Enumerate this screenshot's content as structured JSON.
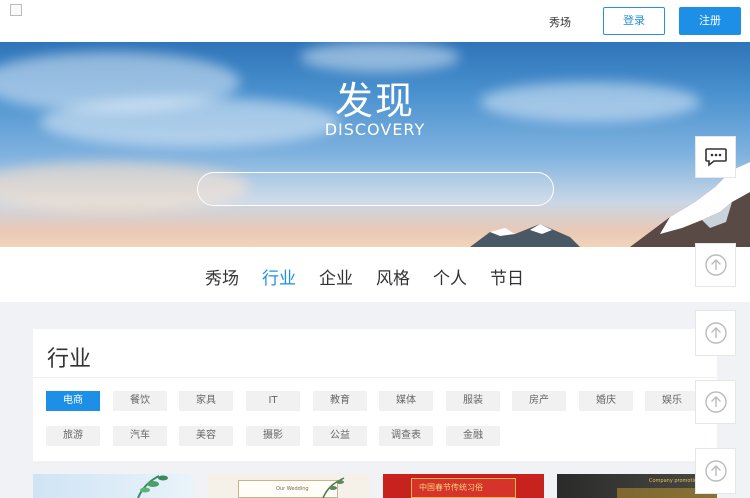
{
  "header": {
    "nav_label": "秀场",
    "login_label": "登录",
    "register_label": "注册"
  },
  "hero": {
    "title": "发现",
    "subtitle": "DISCOVERY",
    "search_placeholder": ""
  },
  "category_nav": {
    "items": [
      "秀场",
      "行业",
      "企业",
      "风格",
      "个人",
      "节日"
    ],
    "active_index": 1
  },
  "panel": {
    "title": "行业",
    "tags_row1": [
      "电商",
      "餐饮",
      "家具",
      "IT",
      "教育",
      "媒体",
      "服装",
      "房产",
      "婚庆",
      "娱乐"
    ],
    "tags_row2": [
      "旅游",
      "汽车",
      "美容",
      "摄影",
      "公益",
      "调查表",
      "金融"
    ],
    "active_tag": "电商"
  },
  "thumbnails": {
    "thumb2_text": "Our Wedding",
    "thumb3_text": "中国春节传统习俗",
    "thumb4_text": "Company promotion"
  },
  "colors": {
    "accent": "#1e8fe6",
    "header_bg": "#ffffff",
    "page_bg": "#f0f2f5"
  },
  "icons": {
    "chat": "chat-bubble-icon",
    "up": "arrow-up-circle-icon"
  }
}
